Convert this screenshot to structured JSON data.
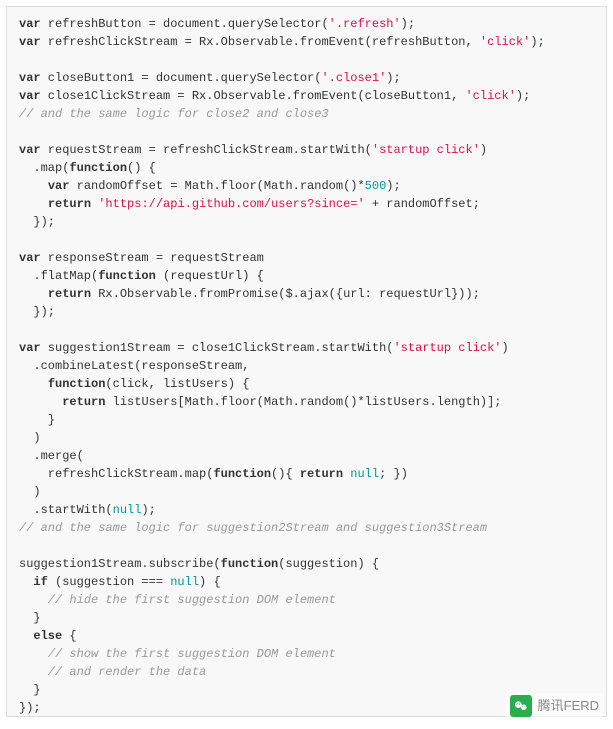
{
  "watermark": {
    "text": "腾讯FERD"
  },
  "code": {
    "lines": [
      [
        [
          "k",
          "var"
        ],
        [
          "p",
          " refreshButton = document.querySelector("
        ],
        [
          "s",
          "'.refresh'"
        ],
        [
          "p",
          ");"
        ]
      ],
      [
        [
          "k",
          "var"
        ],
        [
          "p",
          " refreshClickStream = Rx.Observable.fromEvent(refreshButton, "
        ],
        [
          "s",
          "'click'"
        ],
        [
          "p",
          ");"
        ]
      ],
      [],
      [
        [
          "k",
          "var"
        ],
        [
          "p",
          " closeButton1 = document.querySelector("
        ],
        [
          "s",
          "'.close1'"
        ],
        [
          "p",
          ");"
        ]
      ],
      [
        [
          "k",
          "var"
        ],
        [
          "p",
          " close1ClickStream = Rx.Observable.fromEvent(closeButton1, "
        ],
        [
          "s",
          "'click'"
        ],
        [
          "p",
          ");"
        ]
      ],
      [
        [
          "c",
          "// and the same logic for close2 and close3"
        ]
      ],
      [],
      [
        [
          "k",
          "var"
        ],
        [
          "p",
          " requestStream = refreshClickStream.startWith("
        ],
        [
          "s",
          "'startup click'"
        ],
        [
          "p",
          ")"
        ]
      ],
      [
        [
          "p",
          "  .map("
        ],
        [
          "k",
          "function"
        ],
        [
          "p",
          "() {"
        ]
      ],
      [
        [
          "p",
          "    "
        ],
        [
          "k",
          "var"
        ],
        [
          "p",
          " randomOffset = Math.floor(Math.random()*"
        ],
        [
          "n",
          "500"
        ],
        [
          "p",
          ");"
        ]
      ],
      [
        [
          "p",
          "    "
        ],
        [
          "k",
          "return"
        ],
        [
          "p",
          " "
        ],
        [
          "s",
          "'https://api.github.com/users?since='"
        ],
        [
          "p",
          " + randomOffset;"
        ]
      ],
      [
        [
          "p",
          "  });"
        ]
      ],
      [],
      [
        [
          "k",
          "var"
        ],
        [
          "p",
          " responseStream = requestStream"
        ]
      ],
      [
        [
          "p",
          "  .flatMap("
        ],
        [
          "k",
          "function"
        ],
        [
          "p",
          " (requestUrl) {"
        ]
      ],
      [
        [
          "p",
          "    "
        ],
        [
          "k",
          "return"
        ],
        [
          "p",
          " Rx.Observable.fromPromise($.ajax({url: requestUrl}));"
        ]
      ],
      [
        [
          "p",
          "  });"
        ]
      ],
      [],
      [
        [
          "k",
          "var"
        ],
        [
          "p",
          " suggestion1Stream = close1ClickStream.startWith("
        ],
        [
          "s",
          "'startup click'"
        ],
        [
          "p",
          ")"
        ]
      ],
      [
        [
          "p",
          "  .combineLatest(responseStream,"
        ]
      ],
      [
        [
          "p",
          "    "
        ],
        [
          "k",
          "function"
        ],
        [
          "p",
          "(click, listUsers) {"
        ]
      ],
      [
        [
          "p",
          "      "
        ],
        [
          "k",
          "return"
        ],
        [
          "p",
          " listUsers[Math.floor(Math.random()*listUsers.length)];"
        ]
      ],
      [
        [
          "p",
          "    }"
        ]
      ],
      [
        [
          "p",
          "  )"
        ]
      ],
      [
        [
          "p",
          "  .merge("
        ]
      ],
      [
        [
          "p",
          "    refreshClickStream.map("
        ],
        [
          "k",
          "function"
        ],
        [
          "p",
          "(){ "
        ],
        [
          "k",
          "return"
        ],
        [
          "p",
          " "
        ],
        [
          "b",
          "null"
        ],
        [
          "p",
          "; })"
        ]
      ],
      [
        [
          "p",
          "  )"
        ]
      ],
      [
        [
          "p",
          "  .startWith("
        ],
        [
          "b",
          "null"
        ],
        [
          "p",
          ");"
        ]
      ],
      [
        [
          "c",
          "// and the same logic for suggestion2Stream and suggestion3Stream"
        ]
      ],
      [],
      [
        [
          "p",
          "suggestion1Stream.subscribe("
        ],
        [
          "k",
          "function"
        ],
        [
          "p",
          "(suggestion) {"
        ]
      ],
      [
        [
          "p",
          "  "
        ],
        [
          "k",
          "if"
        ],
        [
          "p",
          " (suggestion === "
        ],
        [
          "b",
          "null"
        ],
        [
          "p",
          ") {"
        ]
      ],
      [
        [
          "p",
          "    "
        ],
        [
          "c",
          "// hide the first suggestion DOM element"
        ]
      ],
      [
        [
          "p",
          "  }"
        ]
      ],
      [
        [
          "p",
          "  "
        ],
        [
          "k",
          "else"
        ],
        [
          "p",
          " {"
        ]
      ],
      [
        [
          "p",
          "    "
        ],
        [
          "c",
          "// show the first suggestion DOM element"
        ]
      ],
      [
        [
          "p",
          "    "
        ],
        [
          "c",
          "// and render the data"
        ]
      ],
      [
        [
          "p",
          "  }"
        ]
      ],
      [
        [
          "p",
          "});"
        ]
      ]
    ]
  }
}
